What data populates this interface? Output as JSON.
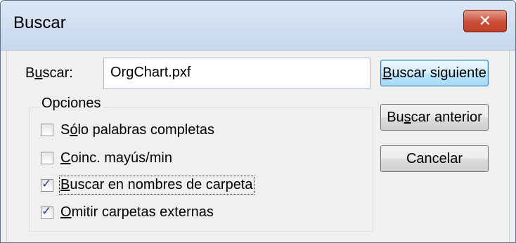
{
  "window": {
    "title": "Buscar",
    "close_glyph": "✕"
  },
  "search": {
    "label_prefix": "B",
    "label_accel": "u",
    "label_suffix": "scar:",
    "value": "OrgChart.pxf"
  },
  "options": {
    "legend": "Opciones",
    "items": [
      {
        "pre": "S",
        "acc": "ó",
        "post": "lo palabras completas",
        "checked": false
      },
      {
        "pre": "",
        "acc": "C",
        "post": "oinc. mayús/min",
        "checked": false
      },
      {
        "pre": "",
        "acc": "B",
        "post": "uscar en nombres de carpeta",
        "checked": true
      },
      {
        "pre": "",
        "acc": "O",
        "post": "mitir carpetas externas",
        "checked": true
      }
    ]
  },
  "buttons": [
    {
      "pre": "",
      "acc": "B",
      "post": "uscar siguiente"
    },
    {
      "pre": "Bu",
      "acc": "s",
      "post": "car anterior"
    },
    {
      "pre": "",
      "acc": "",
      "post": "Cancelar"
    }
  ],
  "colors": {
    "check": "#1f3f8f",
    "close_red": "#c94d36",
    "title_bar": "#c6d7ee"
  }
}
